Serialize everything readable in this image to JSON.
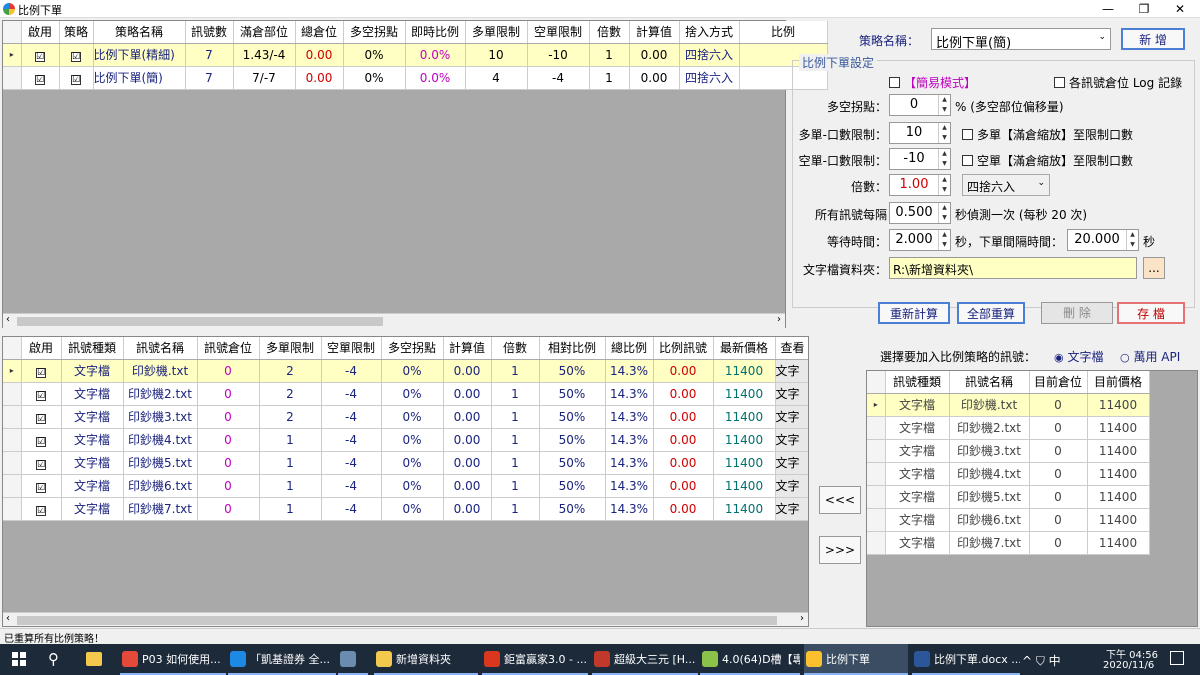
{
  "window": {
    "title": "比例下單"
  },
  "strategy_table": {
    "headers": [
      "啟用",
      "策略",
      "策略名稱",
      "訊號數",
      "滿倉部位",
      "總倉位",
      "多空拐點",
      "即時比例",
      "多單限制",
      "空單限制",
      "倍數",
      "計算值",
      "捨入方式",
      "比例"
    ],
    "rows": [
      {
        "enabled": "☑",
        "strategy": "☑",
        "name": "比例下單(精細)",
        "signals": "7",
        "full": "1.43/-4",
        "total": "0.00",
        "pivot": "0%",
        "ratio": "0.0%",
        "long": "10",
        "short": "-10",
        "mult": "1",
        "calc": "0.00",
        "round": "四捨六入",
        "selected": true
      },
      {
        "enabled": "☑",
        "strategy": "☑",
        "name": "比例下單(簡)",
        "signals": "7",
        "full": "7/-7",
        "total": "0.00",
        "pivot": "0%",
        "ratio": "0.0%",
        "long": "4",
        "short": "-4",
        "mult": "1",
        "calc": "0.00",
        "round": "四捨六入",
        "selected": false
      }
    ]
  },
  "settings": {
    "strategy_label": "策略名稱：",
    "strategy_value": "比例下單(簡)",
    "new_btn": "新 增",
    "group_title": "比例下單設定",
    "simple_mode": "【簡易模式】",
    "log_label": "各訊號倉位 Log 記錄",
    "pivot_label": "多空拐點：",
    "pivot_value": "0",
    "pivot_suffix": "% (多空部位偏移量)",
    "long_label": "多單-口數限制：",
    "long_value": "10",
    "long_chk": "多單【滿倉縮放】至限制口數",
    "short_label": "空單-口數限制：",
    "short_value": "-10",
    "short_chk": "空單【滿倉縮放】至限制口數",
    "mult_label": "倍數：",
    "mult_value": "1.00",
    "round_value": "四捨六入",
    "interval_label": "所有訊號每隔",
    "interval_value": "0.500",
    "interval_suffix": "秒偵測一次 (每秒 20 次)",
    "wait_label": "等待時間：",
    "wait_value": "2.000",
    "wait_mid": "秒，下單間隔時間：",
    "order_value": "20.000",
    "order_suffix": "秒",
    "folder_label": "文字檔資料夾：",
    "folder_value": "R:\\新增資料夾\\",
    "browse": "...",
    "recalc_btn": "重新計算",
    "reset_all_btn": "全部重算",
    "delete_btn": "刪 除",
    "save_btn": "存 檔"
  },
  "signal_table": {
    "headers": [
      "啟用",
      "訊號種類",
      "訊號名稱",
      "訊號倉位",
      "多單限制",
      "空單限制",
      "多空拐點",
      "計算值",
      "倍數",
      "相對比例",
      "總比例",
      "比例訊號",
      "最新價格",
      "查看"
    ],
    "rows": [
      {
        "type": "文字檔",
        "name": "印鈔機.txt",
        "pos": "0",
        "long": "2",
        "short": "-4",
        "pivot": "0%",
        "calc": "0.00",
        "mult": "1",
        "rel": "50%",
        "total": "14.3%",
        "sig": "0.00",
        "price": "11400",
        "view": "文字",
        "selected": true
      },
      {
        "type": "文字檔",
        "name": "印鈔機2.txt",
        "pos": "0",
        "long": "2",
        "short": "-4",
        "pivot": "0%",
        "calc": "0.00",
        "mult": "1",
        "rel": "50%",
        "total": "14.3%",
        "sig": "0.00",
        "price": "11400",
        "view": "文字",
        "selected": false
      },
      {
        "type": "文字檔",
        "name": "印鈔機3.txt",
        "pos": "0",
        "long": "2",
        "short": "-4",
        "pivot": "0%",
        "calc": "0.00",
        "mult": "1",
        "rel": "50%",
        "total": "14.3%",
        "sig": "0.00",
        "price": "11400",
        "view": "文字",
        "selected": false
      },
      {
        "type": "文字檔",
        "name": "印鈔機4.txt",
        "pos": "0",
        "long": "1",
        "short": "-4",
        "pivot": "0%",
        "calc": "0.00",
        "mult": "1",
        "rel": "50%",
        "total": "14.3%",
        "sig": "0.00",
        "price": "11400",
        "view": "文字",
        "selected": false
      },
      {
        "type": "文字檔",
        "name": "印鈔機5.txt",
        "pos": "0",
        "long": "1",
        "short": "-4",
        "pivot": "0%",
        "calc": "0.00",
        "mult": "1",
        "rel": "50%",
        "total": "14.3%",
        "sig": "0.00",
        "price": "11400",
        "view": "文字",
        "selected": false
      },
      {
        "type": "文字檔",
        "name": "印鈔機6.txt",
        "pos": "0",
        "long": "1",
        "short": "-4",
        "pivot": "0%",
        "calc": "0.00",
        "mult": "1",
        "rel": "50%",
        "total": "14.3%",
        "sig": "0.00",
        "price": "11400",
        "view": "文字",
        "selected": false
      },
      {
        "type": "文字檔",
        "name": "印鈔機7.txt",
        "pos": "0",
        "long": "1",
        "short": "-4",
        "pivot": "0%",
        "calc": "0.00",
        "mult": "1",
        "rel": "50%",
        "total": "14.3%",
        "sig": "0.00",
        "price": "11400",
        "view": "文字",
        "selected": false
      }
    ]
  },
  "move_buttons": {
    "add": "<<<",
    "remove": ">>>"
  },
  "source": {
    "prompt": "選擇要加入比例策略的訊號：",
    "opt_text": "文字檔",
    "opt_api": "萬用 API",
    "headers": [
      "訊號種類",
      "訊號名稱",
      "目前倉位",
      "目前價格"
    ],
    "rows": [
      {
        "type": "文字檔",
        "name": "印鈔機.txt",
        "pos": "0",
        "price": "11400",
        "selected": true
      },
      {
        "type": "文字檔",
        "name": "印鈔機2.txt",
        "pos": "0",
        "price": "11400",
        "selected": false
      },
      {
        "type": "文字檔",
        "name": "印鈔機3.txt",
        "pos": "0",
        "price": "11400",
        "selected": false
      },
      {
        "type": "文字檔",
        "name": "印鈔機4.txt",
        "pos": "0",
        "price": "11400",
        "selected": false
      },
      {
        "type": "文字檔",
        "name": "印鈔機5.txt",
        "pos": "0",
        "price": "11400",
        "selected": false
      },
      {
        "type": "文字檔",
        "name": "印鈔機6.txt",
        "pos": "0",
        "price": "11400",
        "selected": false
      },
      {
        "type": "文字檔",
        "name": "印鈔機7.txt",
        "pos": "0",
        "price": "11400",
        "selected": false
      }
    ]
  },
  "status": "已重算所有比例策略！",
  "taskbar": {
    "items": [
      {
        "label": "P03 如何使用...",
        "color": "#e5493a"
      },
      {
        "label": "「凱基證券 全...",
        "color": "#1e88e5"
      },
      {
        "label": "",
        "color": "#6a8caf"
      },
      {
        "label": "新增資料夾",
        "color": "#f2c94c"
      },
      {
        "label": "鉅富贏家3.0 - ...",
        "color": "#d9381e"
      },
      {
        "label": "超級大三元 [H...",
        "color": "#c0392b"
      },
      {
        "label": "4.0(64)D槽【專...",
        "color": "#8bc34a"
      },
      {
        "label": "比例下單",
        "color": "#fbc02d"
      },
      {
        "label": "比例下單.docx ...",
        "color": "#2b579a"
      }
    ],
    "tray": "^ ⛉ 中",
    "time": "下午 04:56",
    "date": "2020/11/6"
  }
}
